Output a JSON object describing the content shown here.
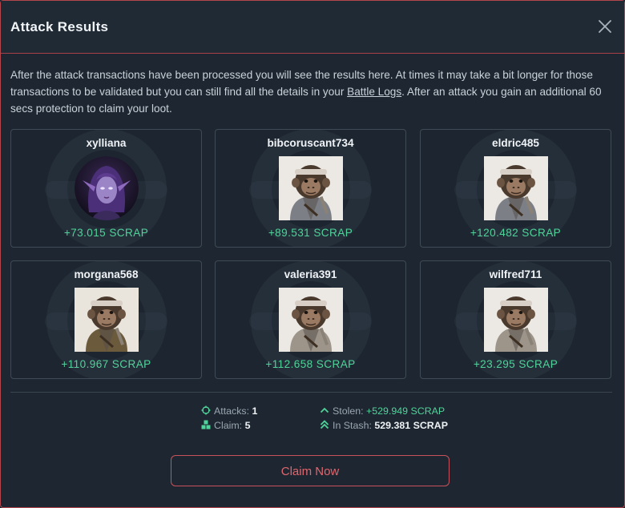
{
  "modal": {
    "title": "Attack Results",
    "description_part1": "After the attack transactions have been processed you will see the results here. At times it may take a bit longer for those transactions to be validated but you can still find all the details in your ",
    "battle_logs_link": "Battle Logs",
    "description_part2": ". After an attack you gain an additional 60 secs protection to claim your loot."
  },
  "results": [
    {
      "name": "xylliana",
      "gain": "+73.015 SCRAP",
      "avatar": "elf-avatar"
    },
    {
      "name": "bibcoruscant734",
      "gain": "+89.531 SCRAP",
      "avatar": "monkey-avatar"
    },
    {
      "name": "eldric485",
      "gain": "+120.482 SCRAP",
      "avatar": "monkey-avatar"
    },
    {
      "name": "morgana568",
      "gain": "+110.967 SCRAP",
      "avatar": "monkey-avatar"
    },
    {
      "name": "valeria391",
      "gain": "+112.658 SCRAP",
      "avatar": "monkey-avatar"
    },
    {
      "name": "wilfred711",
      "gain": "+23.295 SCRAP",
      "avatar": "monkey-avatar"
    }
  ],
  "stats": {
    "attacks_label": "Attacks:",
    "attacks_value": "1",
    "claim_label": "Claim:",
    "claim_value": "5",
    "stolen_label": "Stolen:",
    "stolen_value": "+529.949 SCRAP",
    "stash_label": "In Stash:",
    "stash_value": "529.381 SCRAP"
  },
  "claim_button": "Claim Now",
  "colors": {
    "accent_red": "#c8525b",
    "gain_green": "#4fd39a",
    "background": "#1e2731"
  }
}
